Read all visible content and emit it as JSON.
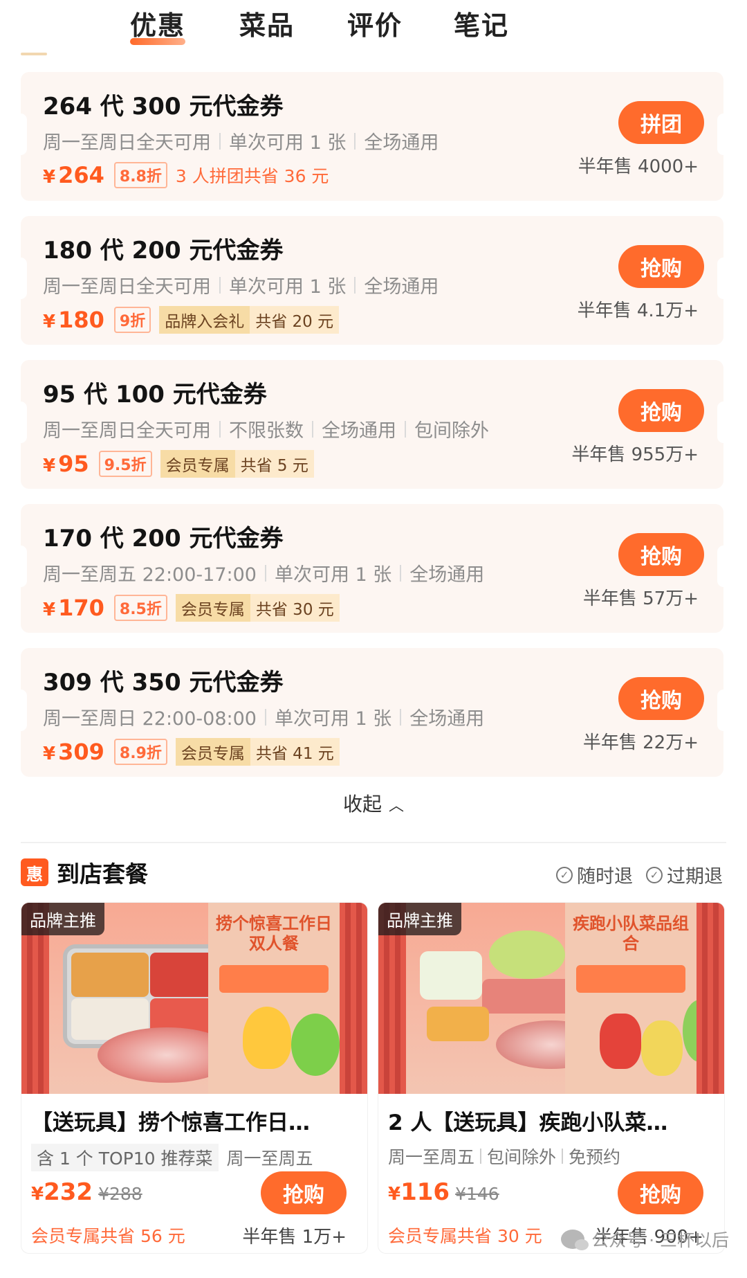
{
  "tabs": [
    {
      "label": "优惠"
    },
    {
      "label": "菜品"
    },
    {
      "label": "评价"
    },
    {
      "label": "笔记"
    }
  ],
  "vouchers": [
    {
      "title": "264 代 300 元代金券",
      "rules": [
        "周一至周日全天可用",
        "单次可用 1 张",
        "全场通用"
      ],
      "currency": "¥",
      "price": "264",
      "discount": "8.8折",
      "save_text": "3 人拼团共省 36 元",
      "button": "拼团",
      "sales": "半年售 4000+"
    },
    {
      "title": "180 代 200 元代金券",
      "rules": [
        "周一至周日全天可用",
        "单次可用 1 张",
        "全场通用"
      ],
      "currency": "¥",
      "price": "180",
      "discount": "9折",
      "badge": "品牌入会礼",
      "save_pill": "共省 20 元",
      "button": "抢购",
      "sales": "半年售 4.1万+"
    },
    {
      "title": "95 代 100 元代金券",
      "rules": [
        "周一至周日全天可用",
        "不限张数",
        "全场通用",
        "包间除外"
      ],
      "currency": "¥",
      "price": "95",
      "discount": "9.5折",
      "badge": "会员专属",
      "save_pill": "共省 5 元",
      "button": "抢购",
      "sales": "半年售 955万+"
    },
    {
      "title": "170 代 200 元代金券",
      "rules": [
        "周一至周五 22:00-17:00",
        "单次可用 1 张",
        "全场通用"
      ],
      "currency": "¥",
      "price": "170",
      "discount": "8.5折",
      "badge": "会员专属",
      "save_pill": "共省 30 元",
      "button": "抢购",
      "sales": "半年售 57万+"
    },
    {
      "title": "309 代 350 元代金券",
      "rules": [
        "周一至周日 22:00-08:00",
        "单次可用 1 张",
        "全场通用"
      ],
      "currency": "¥",
      "price": "309",
      "discount": "8.9折",
      "badge": "会员专属",
      "save_pill": "共省 41 元",
      "button": "抢购",
      "sales": "半年售 22万+"
    }
  ],
  "collapse": {
    "label": "收起",
    "icon": "chevron-up-icon"
  },
  "packages_section": {
    "icon_text": "惠",
    "title": "到店套餐",
    "refund_anytime": "随时退",
    "refund_expired": "过期退"
  },
  "packages": [
    {
      "tag": "品牌主推",
      "poster_title": "捞个惊喜工作日 双人餐",
      "name": "【送玩具】捞个惊喜工作日…",
      "chip": "含 1 个 TOP10 推荐菜",
      "info": [
        "周一至周五"
      ],
      "currency": "¥",
      "price": "232",
      "old_price": "¥288",
      "save_text": "会员专属共省 56 元",
      "button": "抢购",
      "sales": "半年售 1万+"
    },
    {
      "tag": "品牌主推",
      "poster_title": "疾跑小队菜品组合",
      "name": "2 人【送玩具】疾跑小队菜…",
      "chip": "",
      "info": [
        "周一至周五",
        "包间除外",
        "免预约"
      ],
      "currency": "¥",
      "price": "116",
      "old_price": "¥146",
      "save_text": "会员专属共省 30 元",
      "button": "抢购",
      "sales": "半年售 900+"
    }
  ],
  "watermark": "公众号 · 三杯以后",
  "colors": {
    "accent": "#ff6b2c",
    "price": "#ff5a1f",
    "card_bg": "#fdf6f2",
    "badge_bg": "#f7dca6"
  }
}
